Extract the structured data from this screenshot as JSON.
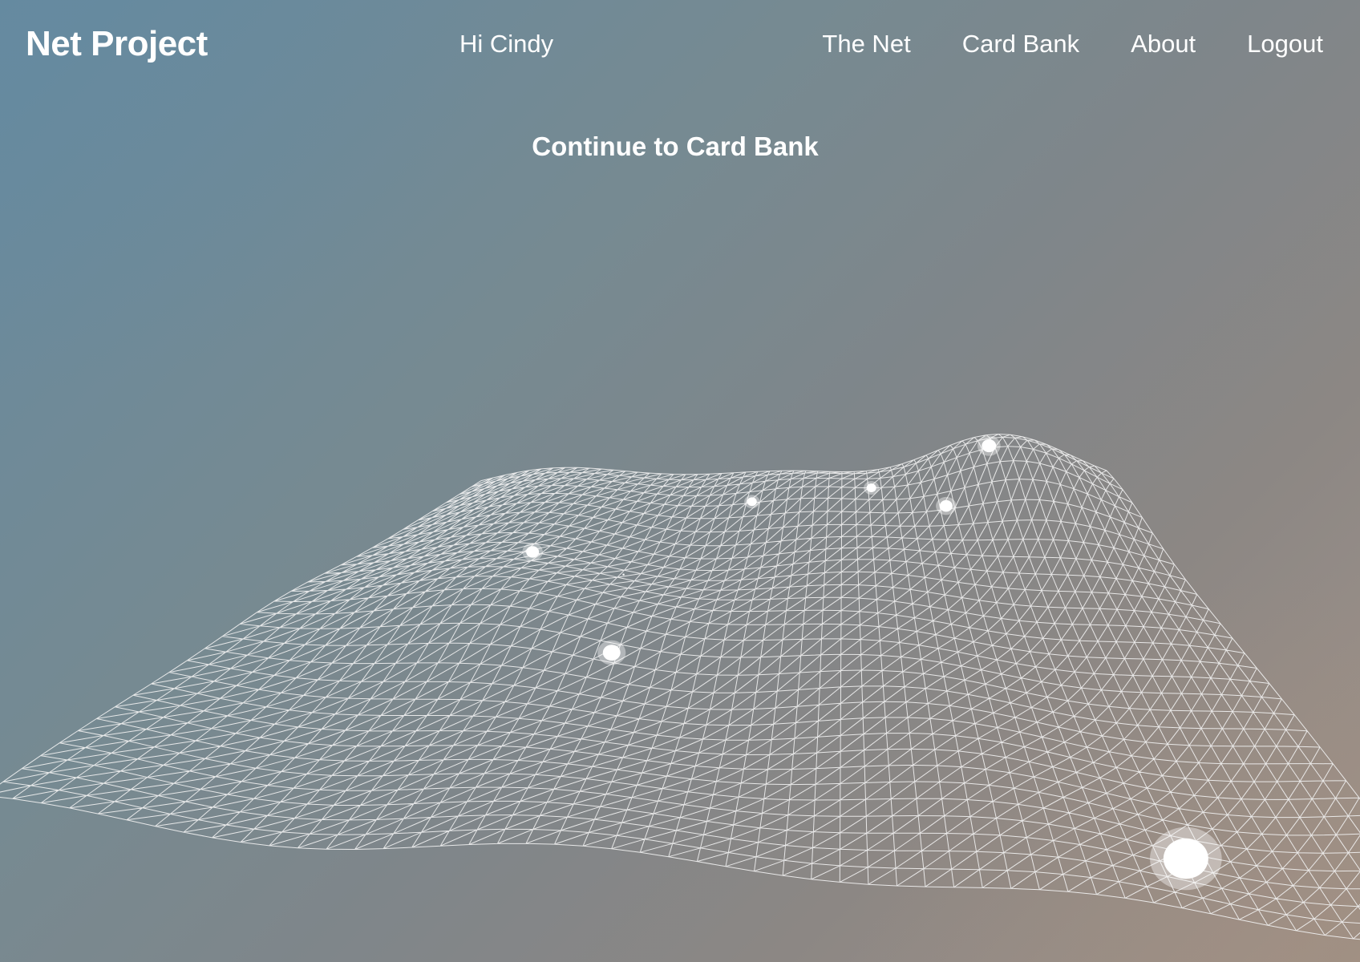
{
  "app": {
    "brand": "Net Project"
  },
  "header": {
    "greeting": "Hi Cindy",
    "nav": [
      {
        "id": "the-net",
        "label": "The Net"
      },
      {
        "id": "card-bank",
        "label": "Card Bank"
      },
      {
        "id": "about",
        "label": "About"
      },
      {
        "id": "logout",
        "label": "Logout"
      }
    ]
  },
  "main": {
    "cta_label": "Continue to Card Bank",
    "visualization": {
      "mesh_color": "#f2f2f2",
      "node_color": "#ffffff",
      "node_count": 8
    }
  },
  "colors": {
    "background_start": "#668aa0",
    "background_end": "#a2948a",
    "text": "#ffffff"
  }
}
